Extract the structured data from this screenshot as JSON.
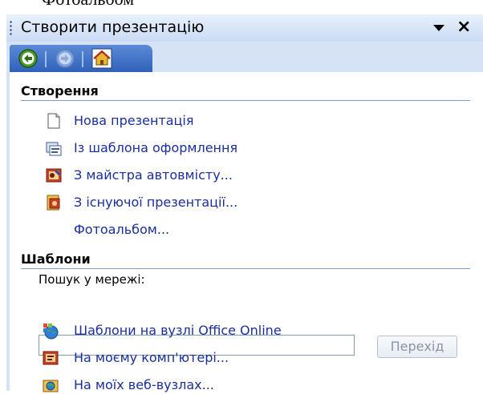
{
  "cut_text": "Фотоальбом",
  "pane": {
    "title": "Створити презентацію",
    "menu_icon": "dropdown-arrow-icon",
    "close_icon": "close-icon"
  },
  "nav": {
    "back_icon": "back-arrow-icon",
    "forward_icon": "forward-arrow-icon",
    "home_icon": "home-icon"
  },
  "create": {
    "heading": "Створення",
    "items": [
      {
        "label": "Нова презентація",
        "icon": "blank-document-icon"
      },
      {
        "label": "Із шаблона оформлення",
        "icon": "design-template-icon"
      },
      {
        "label": "З майстра автовмісту...",
        "icon": "autocontent-wizard-icon"
      },
      {
        "label": "З існуючої презентації...",
        "icon": "existing-presentation-icon"
      },
      {
        "label": "Фотоальбом..."
      }
    ]
  },
  "templates": {
    "heading": "Шаблони",
    "search_label": "Пошук у мережі:",
    "search_value": "",
    "go_label": "Перехід",
    "items": [
      {
        "label": "Шаблони на вузлі Office Online",
        "icon": "office-online-icon"
      },
      {
        "label": "На моєму комп'ютері...",
        "icon": "my-computer-templates-icon"
      },
      {
        "label": "На моїх веб-вузлах...",
        "icon": "web-sites-icon"
      }
    ]
  },
  "colors": {
    "pane_bg": "#d6e3f6",
    "nav_bar": "#2f62b7",
    "link_text": "#1a2f9d"
  }
}
